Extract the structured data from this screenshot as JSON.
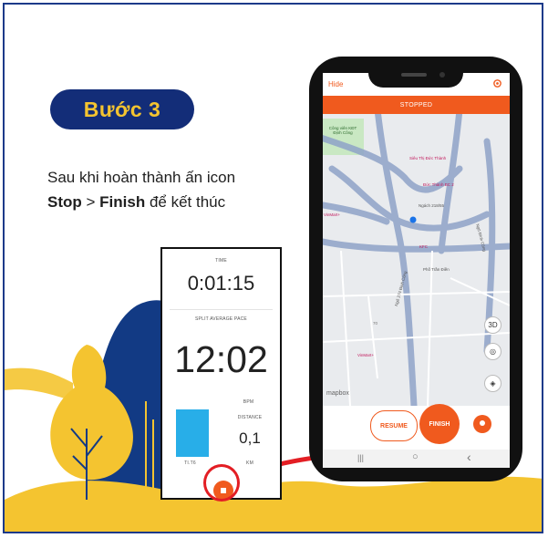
{
  "slide": {
    "step_badge": "Bước 3",
    "instruction": {
      "line1": "Sau khi hoàn thành ấn  icon",
      "stop": "Stop",
      "sep": " > ",
      "finish": "Finish",
      "tail": " để kết thúc"
    }
  },
  "stopwatch": {
    "time_label": "TIME",
    "time_value": "0:01:15",
    "pace_label": "SPLIT AVERAGE PACE",
    "pace_value": "12:02",
    "bpm_label": "BPM",
    "distance_label": "DISTANCE",
    "distance_value": "0,1",
    "distance_unit": "KM",
    "bar_caption": "TI.T6"
  },
  "phone": {
    "hide_label": "Hide",
    "status": "STOPPED",
    "map": {
      "labels": {
        "park": "Công viên KĐT Định Công",
        "store1": "Siêu Thị Đức Thành",
        "store2": "Đức Thành BC 2",
        "alley": "Ngách 218/55",
        "vinmart1": "VinMart+",
        "kfc": "KFC",
        "street1": "Phố Trần Điền",
        "street2": "Ngõ 274 Định Công",
        "street3": "Ngõ Đình Công",
        "vinmart2": "VinMart+",
        "mapbox": "mapbox",
        "number": "70"
      },
      "btn_3d": "3D"
    },
    "resume_label": "RESUME",
    "finish_label": "FINISH",
    "nav": {
      "recent": "|||",
      "home": "○",
      "back": "‹"
    }
  },
  "colors": {
    "brand_orange": "#f05a1e",
    "badge_navy": "#132d78",
    "badge_yellow": "#f4c430",
    "highlight_red": "#e31e24",
    "pace_bar": "#28aee8"
  },
  "icons": [
    "gear-icon",
    "locate-icon",
    "layers-icon",
    "location-pin-icon",
    "stop-icon"
  ]
}
